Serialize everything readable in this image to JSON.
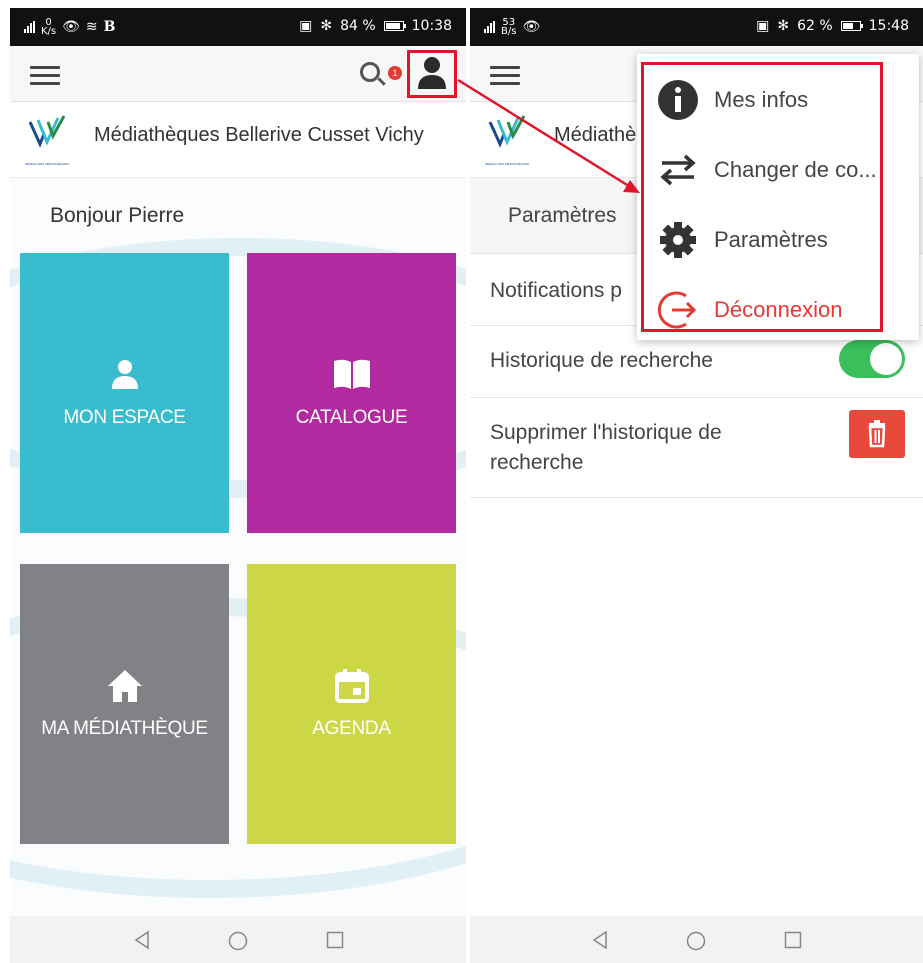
{
  "left": {
    "status": {
      "netspeed_value": "0",
      "netspeed_unit": "K/s",
      "battery": "84 %",
      "time": "10:38"
    },
    "header": {
      "notification_count": "1"
    },
    "library_name": "Médiathèques Bellerive Cusset Vichy",
    "greeting": "Bonjour Pierre",
    "tiles": [
      {
        "label": "MON ESPACE",
        "color": "#39bccd"
      },
      {
        "label": "CATALOGUE",
        "color": "#b22aa0"
      },
      {
        "label": "MA MÉDIATHÈQUE",
        "color": "#808286"
      },
      {
        "label": "AGENDA",
        "color": "#cdd745"
      }
    ]
  },
  "right": {
    "status": {
      "netspeed_value": "53",
      "netspeed_unit": "B/s",
      "battery": "62 %",
      "time": "15:48"
    },
    "library_name_truncated": "Médiathè",
    "page_title": "Paramètres",
    "settings": [
      {
        "label": "Notifications p"
      },
      {
        "label": "Historique de recherche",
        "toggle_on": true
      },
      {
        "label_line1": "Supprimer l'historique de",
        "label_line2": "recherche"
      }
    ],
    "user_menu": [
      {
        "label": "Mes infos",
        "icon": "info-icon"
      },
      {
        "label": "Changer de co...",
        "icon": "swap-arrows-icon"
      },
      {
        "label": "Paramètres",
        "icon": "gear-icon"
      },
      {
        "label": "Déconnexion",
        "icon": "logout-icon",
        "color": "#e53935"
      }
    ]
  },
  "colors": {
    "highlight": "#e0142b",
    "toggle_on": "#3bbf5b",
    "danger": "#e8493b"
  }
}
